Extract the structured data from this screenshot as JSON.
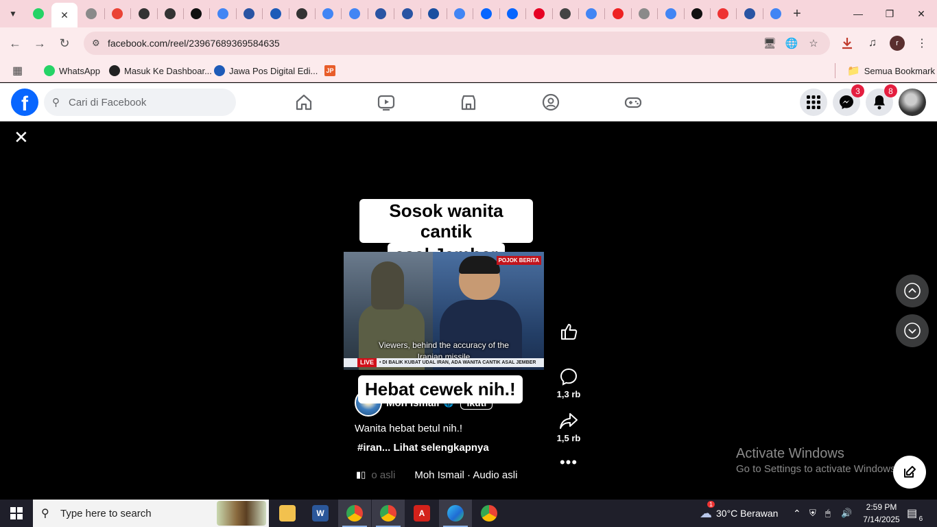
{
  "browser": {
    "tabs": [
      {
        "icon": "whatsapp-icon",
        "color": "#25d366"
      },
      {
        "icon": "facebook-icon",
        "color": "#0866ff",
        "active": true
      },
      {
        "icon": "globe-icon",
        "color": "#8a8a8a"
      },
      {
        "icon": "gmail-icon",
        "color": "#ea4335"
      },
      {
        "icon": "jp-icon",
        "color": "#333"
      },
      {
        "icon": "speaker-icon",
        "color": "#333"
      },
      {
        "icon": "threads-icon",
        "color": "#111"
      },
      {
        "icon": "google-icon",
        "color": "#4285f4"
      },
      {
        "icon": "detik-icon",
        "color": "#2a54a3"
      },
      {
        "icon": "jawapos-icon",
        "color": "#1e5bb8"
      },
      {
        "icon": "jp-icon",
        "color": "#333"
      },
      {
        "icon": "google-icon",
        "color": "#4285f4"
      },
      {
        "icon": "google-icon",
        "color": "#4285f4"
      },
      {
        "icon": "detik-icon",
        "color": "#2a54a3"
      },
      {
        "icon": "detik-icon",
        "color": "#2a54a3"
      },
      {
        "icon": "radar-icon",
        "color": "#1a4fa0"
      },
      {
        "icon": "google-icon",
        "color": "#4285f4"
      },
      {
        "icon": "facebook-icon",
        "color": "#0866ff"
      },
      {
        "icon": "facebook-icon",
        "color": "#0866ff"
      },
      {
        "icon": "pinterest-icon",
        "color": "#e60023"
      },
      {
        "icon": "translate-icon",
        "color": "#444"
      },
      {
        "icon": "google-icon",
        "color": "#4285f4"
      },
      {
        "icon": "ap-icon",
        "color": "#e22"
      },
      {
        "icon": "globe-icon",
        "color": "#8a8a8a"
      },
      {
        "icon": "google-icon",
        "color": "#4285f4"
      },
      {
        "icon": "medium-icon",
        "color": "#111"
      },
      {
        "icon": "record-icon",
        "color": "#e33"
      },
      {
        "icon": "detik-icon",
        "color": "#2a54a3"
      },
      {
        "icon": "google-icon",
        "color": "#4285f4"
      }
    ],
    "url": "facebook.com/reel/23967689369584635",
    "bookmarks": [
      {
        "label": "WhatsApp",
        "icon": "whatsapp-icon",
        "color": "#25d366"
      },
      {
        "label": "Masuk Ke Dashboar...",
        "icon": "dashboard-icon",
        "color": "#222"
      },
      {
        "label": "Jawa Pos Digital Edi...",
        "icon": "jawapos-icon",
        "color": "#1e5bb8"
      }
    ],
    "all_bookmarks_label": "Semua Bookmark",
    "profile_initial": "r"
  },
  "facebook": {
    "search_placeholder": "Cari di Facebook",
    "messenger_badge": "3",
    "notifications_badge": "8"
  },
  "reel": {
    "caption_top_line1": "Sosok wanita cantik",
    "caption_top_line2": "asal Jember",
    "video_tag": "POJOK BERITA",
    "video_subtitle_line1": "Viewers, behind the accuracy of the",
    "video_subtitle_line2": "Iranian missile",
    "live_label": "LIVE",
    "ticker_text": "• DI BALIK KUBAT UDAL IRAN, ADA WANITA CANTIK ASAL JEMBER",
    "caption_bottom": "Hebat cewek nih.!",
    "author": "Moh Ismail",
    "follow_label": "Ikuti",
    "description": "Wanita hebat betul nih.!",
    "hashtag_line": "#iran... Lihat selengkapnya",
    "audio_faded": "o asli",
    "audio": "Moh Ismail · Audio asli",
    "comments_count": "1,3 rb",
    "shares_count": "1,5 rb"
  },
  "watermark": {
    "line1": "Activate Windows",
    "line2": "Go to Settings to activate Windows."
  },
  "taskbar": {
    "search_placeholder": "Type here to search",
    "weather": "30°C  Berawan",
    "weather_badge": "1",
    "time": "2:59 PM",
    "date": "7/14/2025",
    "notification_count": "6"
  }
}
